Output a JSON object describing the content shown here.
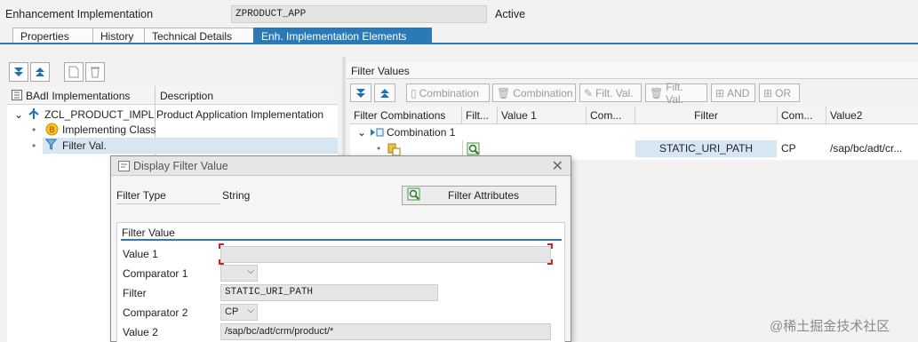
{
  "header": {
    "label": "Enhancement Implementation",
    "value": "ZPRODUCT_APP",
    "status": "Active"
  },
  "tabs": [
    {
      "label": "Properties"
    },
    {
      "label": "History"
    },
    {
      "label": "Technical Details"
    },
    {
      "label": "Enh. Implementation Elements"
    }
  ],
  "left": {
    "toolbar_icons": [
      "expand-all-icon",
      "collapse-all-icon",
      "new-document-icon",
      "delete-icon"
    ],
    "columns": [
      "BAdI Implementations",
      "Description"
    ],
    "tree": [
      {
        "name": "ZCL_PRODUCT_IMPL",
        "description": "Product Application Implementation"
      },
      {
        "name": "Implementing Class",
        "description": ""
      },
      {
        "name": "Filter Val.",
        "description": ""
      }
    ]
  },
  "right": {
    "title": "Filter Values",
    "toolbar": {
      "combination1": "Combination",
      "combination2": "Combination",
      "filt_val1": "Filt. Val.",
      "filt_val2": "Filt. Val.",
      "and": "AND",
      "or": "OR"
    },
    "columns": [
      "Filter Combinations",
      "Filt...",
      "Value 1",
      "Com...",
      "Filter",
      "Com...",
      "Value2"
    ],
    "rows": [
      {
        "combination": "Combination 1"
      },
      {
        "filter": "STATIC_URI_PATH",
        "comparator": "CP",
        "value2": "/sap/bc/adt/cr..."
      }
    ]
  },
  "dialog": {
    "title": "Display Filter Value",
    "filter_type_label": "Filter Type",
    "filter_type_value": "String",
    "attr_button": "Filter Attributes",
    "group_title": "Filter Value",
    "value1_label": "Value 1",
    "value1": "",
    "comparator1_label": "Comparator 1",
    "comparator1": "",
    "filter_label": "Filter",
    "filter_value": "STATIC_URI_PATH",
    "comparator2_label": "Comparator 2",
    "comparator2": "CP",
    "value2_label": "Value 2",
    "value2": "/sap/bc/adt/crm/product/*"
  },
  "watermark": "@稀土掘金技术社区"
}
